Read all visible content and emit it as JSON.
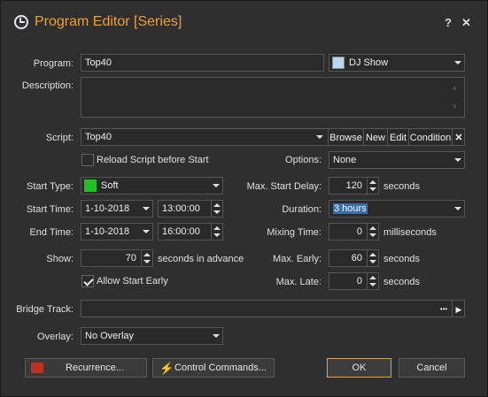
{
  "window": {
    "title": "Program Editor [Series]",
    "help": "?",
    "close": "✕"
  },
  "labels": {
    "program": "Program:",
    "description": "Description:",
    "script": "Script:",
    "start_type": "Start Type:",
    "start_time": "Start Time:",
    "end_time": "End Time:",
    "show": "Show:",
    "bridge_track": "Bridge Track:",
    "overlay": "Overlay:",
    "options": "Options:",
    "max_start_delay": "Max. Start Delay:",
    "duration": "Duration:",
    "mixing_time": "Mixing Time:",
    "max_early": "Max. Early:",
    "max_late": "Max. Late:"
  },
  "values": {
    "program": "Top40",
    "category": "DJ Show",
    "description": "",
    "script": "Top40",
    "options": "None",
    "start_type": "Soft",
    "start_date": "1-10-2018",
    "start_clock": "13:00:00",
    "end_date": "1-10-2018",
    "end_clock": "16:00:00",
    "show": "70",
    "max_start_delay": "120",
    "duration": "3 hours",
    "mixing_time": "0",
    "max_early": "60",
    "max_late": "0",
    "bridge_track": "",
    "overlay": "No Overlay"
  },
  "units": {
    "show": "seconds in advance",
    "max_start_delay": "seconds",
    "mixing_time": "milliseconds",
    "max_early": "seconds",
    "max_late": "seconds"
  },
  "script_buttons": {
    "browse": "Browse",
    "new": "New",
    "edit": "Edit",
    "condition": "Condition",
    "clear": "✕"
  },
  "checkboxes": {
    "reload": "Reload Script before Start",
    "allow_early": "Allow Start Early"
  },
  "buttons": {
    "recurrence": "Recurrence...",
    "control": "Control Commands...",
    "ok": "OK",
    "cancel": "Cancel",
    "ellipsis": "•••",
    "play": "▶"
  },
  "colors": {
    "accent": "#f0a030",
    "category_swatch": "#b8d8f0",
    "soft_swatch": "#22c022",
    "ok_border": "#f0a030"
  },
  "icons": {
    "window": "clock-icon",
    "recurrence": "recurrence-icon",
    "control": "lightning-icon"
  }
}
